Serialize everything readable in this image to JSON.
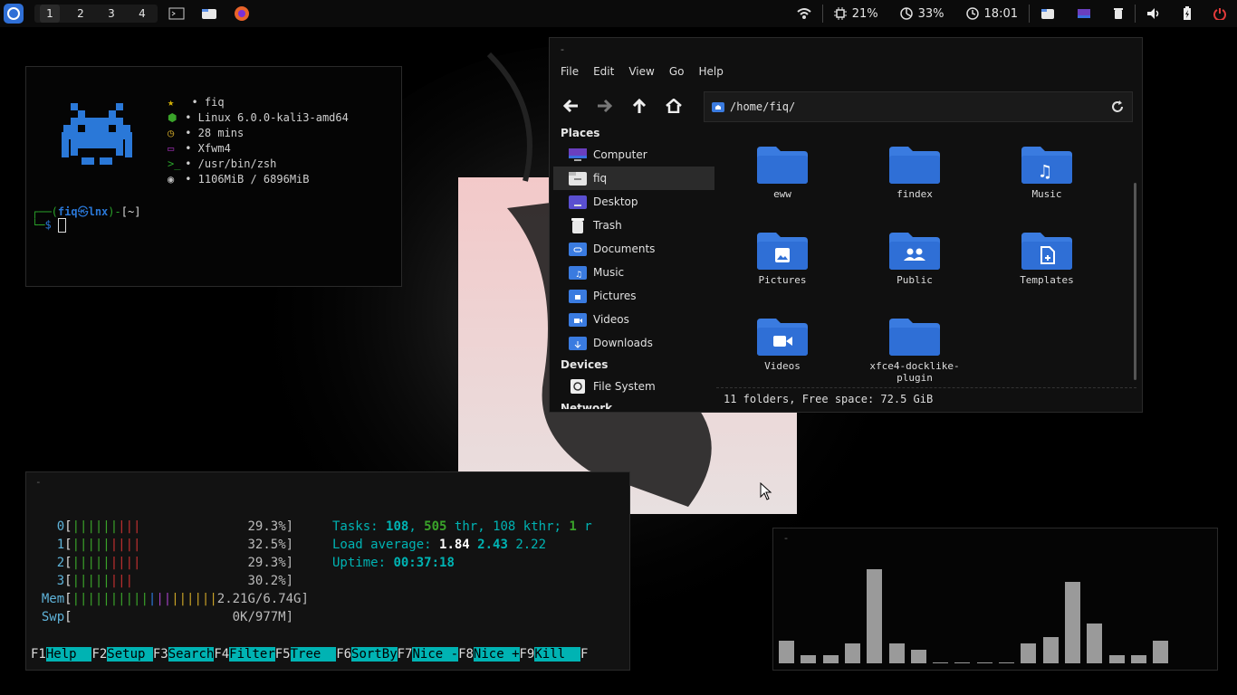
{
  "topbar": {
    "workspaces": [
      "1",
      "2",
      "3",
      "4"
    ],
    "active_workspace": "1",
    "tray": {
      "cpu": "21%",
      "mem": "33%",
      "clock": "18:01"
    }
  },
  "neofetch": {
    "lines": [
      {
        "icon": "star-icon",
        "color": "#d4b106",
        "text": "• fiq"
      },
      {
        "icon": "hex-icon",
        "color": "#3aa32a",
        "text": "• Linux 6.0.0-kali3-amd64"
      },
      {
        "icon": "clock-icon",
        "color": "#c9a227",
        "text": "• 28 mins"
      },
      {
        "icon": "window-icon",
        "color": "#9a2fae",
        "text": "• Xfwm4"
      },
      {
        "icon": "prompt-icon",
        "color": "#2aa32a",
        "text": "• /usr/bin/zsh"
      },
      {
        "icon": "disc-icon",
        "color": "#bbbbbb",
        "text": "• 1106MiB / 6896MiB"
      }
    ],
    "prompt_user": "fiq",
    "prompt_host": "lnx",
    "prompt_dir": "[~]",
    "prompt_symbol": "$"
  },
  "filemanager": {
    "title": "-",
    "menu": [
      "File",
      "Edit",
      "View",
      "Go",
      "Help"
    ],
    "path": "/home/fiq/",
    "sidebar": {
      "places_header": "Places",
      "places": [
        {
          "label": "Computer",
          "icon": "computer-icon"
        },
        {
          "label": "fiq",
          "icon": "home-folder-icon",
          "active": true
        },
        {
          "label": "Desktop",
          "icon": "desktop-icon"
        },
        {
          "label": "Trash",
          "icon": "trash-icon"
        },
        {
          "label": "Documents",
          "icon": "documents-folder-icon"
        },
        {
          "label": "Music",
          "icon": "music-folder-icon"
        },
        {
          "label": "Pictures",
          "icon": "pictures-folder-icon"
        },
        {
          "label": "Videos",
          "icon": "videos-folder-icon"
        },
        {
          "label": "Downloads",
          "icon": "downloads-folder-icon"
        }
      ],
      "devices_header": "Devices",
      "devices": [
        {
          "label": "File System",
          "icon": "drive-icon"
        }
      ],
      "network_header": "Network"
    },
    "folders": [
      {
        "name": "eww",
        "emblem": ""
      },
      {
        "name": "findex",
        "emblem": ""
      },
      {
        "name": "Music",
        "emblem": "music"
      },
      {
        "name": "Pictures",
        "emblem": "pictures"
      },
      {
        "name": "Public",
        "emblem": "public"
      },
      {
        "name": "Templates",
        "emblem": "templates"
      },
      {
        "name": "Videos",
        "emblem": "videos"
      },
      {
        "name": "xfce4-docklike-plugin",
        "emblem": ""
      }
    ],
    "status": "11 folders, Free space: 72.5 GiB"
  },
  "htop": {
    "title": "-",
    "cpus": [
      {
        "id": "0",
        "pct": "29.3%]",
        "green": 8,
        "red": 3
      },
      {
        "id": "1",
        "pct": "32.5%]",
        "green": 6,
        "red": 4
      },
      {
        "id": "2",
        "pct": "29.3%]",
        "green": 6,
        "red": 4
      },
      {
        "id": "3",
        "pct": "30.2%]",
        "green": 6,
        "red": 3
      }
    ],
    "mem": {
      "label": "Mem",
      "value": "2.21G/6.74G]"
    },
    "swp": {
      "label": "Swp",
      "value": "0K/977M]"
    },
    "tasks_label": "Tasks:",
    "tasks_procs": "108",
    "tasks_thr": "505",
    "tasks_thr_label": "thr,",
    "tasks_kthr": "108 kthr;",
    "tasks_running": "1",
    "tasks_r": "r",
    "load_label": "Load average:",
    "load1": "1.84",
    "load5": "2.43",
    "load15": "2.22",
    "uptime_label": "Uptime:",
    "uptime": "00:37:18",
    "fkeys": [
      {
        "key": "F1",
        "label": "Help  "
      },
      {
        "key": "F2",
        "label": "Setup "
      },
      {
        "key": "F3",
        "label": "Search"
      },
      {
        "key": "F4",
        "label": "Filter"
      },
      {
        "key": "F5",
        "label": "Tree  "
      },
      {
        "key": "F6",
        "label": "SortBy"
      },
      {
        "key": "F7",
        "label": "Nice -"
      },
      {
        "key": "F8",
        "label": "Nice +"
      },
      {
        "key": "F9",
        "label": "Kill  "
      },
      {
        "key": "F",
        "label": ""
      }
    ]
  },
  "cava": {
    "title": "-",
    "levels": [
      0.24,
      0.09,
      0.09,
      0.21,
      1.0,
      0.21,
      0.14,
      0.01,
      0.01,
      0.01,
      0.01,
      0.21,
      0.28,
      0.87,
      0.42,
      0.09,
      0.09,
      0.24
    ]
  },
  "colors": {
    "accent": "#2f6fd6",
    "folder": "#3a7be0",
    "cyan": "#00b3b3"
  }
}
